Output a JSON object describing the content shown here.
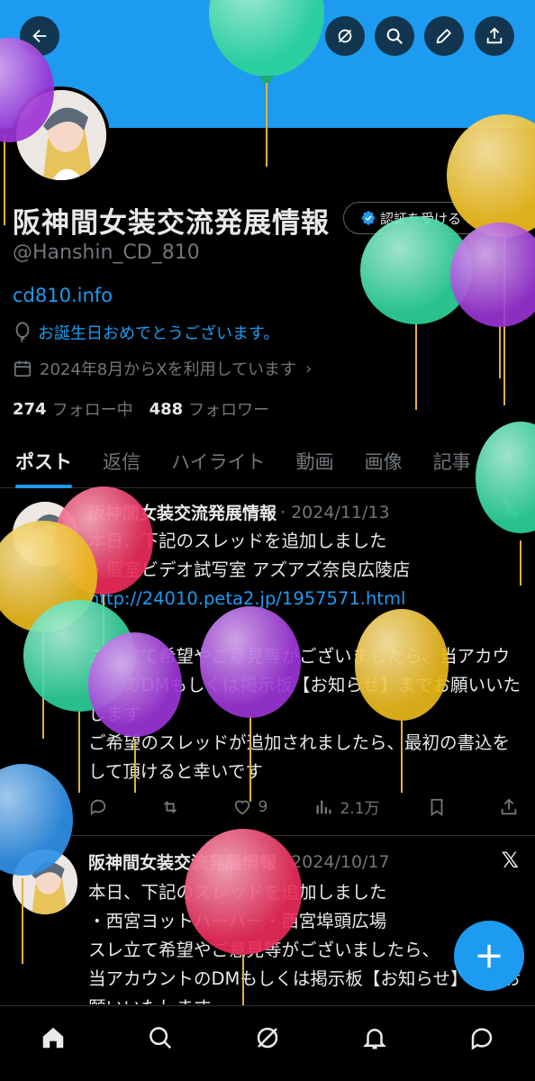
{
  "profile": {
    "name": "阪神間女装交流発展情報",
    "handle": "@Hanshin_CD_810",
    "link": "cd810.info",
    "birthday": "お誕生日おめでとうございます。",
    "joined": "2024年8月からXを利用しています",
    "following_count": "274",
    "following_label": "フォロー中",
    "followers_count": "488",
    "followers_label": "フォロワー",
    "verify_label": "認証を受ける"
  },
  "tabs": [
    {
      "label": "ポスト"
    },
    {
      "label": "返信"
    },
    {
      "label": "ハイライト"
    },
    {
      "label": "動画"
    },
    {
      "label": "画像"
    },
    {
      "label": "記事"
    }
  ],
  "posts": [
    {
      "name": "阪神間女装交流発展情報",
      "date": "· 2024/11/13",
      "line1": "本日、下記のスレッドを追加しました",
      "line2": "・個室ビデオ試写室 アズアズ奈良広陵店",
      "link": "http://24010.peta2.jp/1957571.html",
      "line3": "スレ立て希望やご意見等がございましたら、当アカウントのDMもしくは掲示板【お知らせ】までお願いいたします",
      "line4": "ご希望のスレッドが追加されましたら、最初の書込をして頂けると幸いです",
      "likes": "9",
      "views": "2.1万"
    },
    {
      "name": "阪神間女装交流発展情報",
      "date": "· 2024/10/17",
      "line1": "本日、下記のスレッドを追加しました",
      "line2": "・西宮ヨットハーバー・西宮埠頭広場",
      "line3": "スレ立て希望やご意見等がございましたら、",
      "line4": "当アカウントのDMもしくは掲示板【お知らせ】までお願いいたします"
    }
  ],
  "icons": {
    "back": "back-arrow-icon",
    "grok": "grok-icon",
    "search": "search-icon",
    "edit": "pencil-icon",
    "share": "share-icon"
  },
  "colors": {
    "accent": "#1d9bf0",
    "background": "#000000",
    "muted": "#71767b"
  }
}
